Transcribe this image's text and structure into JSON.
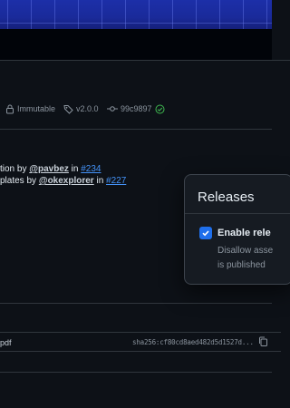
{
  "release": {
    "immutable_label": "Immutable",
    "tag": "v2.0.0",
    "commit": "99c9897"
  },
  "notes": {
    "line1_prefix": "tion by ",
    "line1_user": "@pavbez",
    "line1_mid": " in ",
    "line1_pr": "#234",
    "line2_prefix": "plates by ",
    "line2_user": "@okexplorer",
    "line2_mid": " in ",
    "line2_pr": "#227"
  },
  "asset": {
    "name": "pdf",
    "sha": "sha256:cf80cd8aed482d5d1527d..."
  },
  "popover": {
    "title": "Releases",
    "option_label": "Enable rele",
    "option_desc_line1": "Disallow asse",
    "option_desc_line2": "is published",
    "checked": true
  },
  "colors": {
    "accent": "#1f6feb",
    "link": "#4493f8",
    "success": "#3fb950",
    "muted": "#8b949e"
  }
}
